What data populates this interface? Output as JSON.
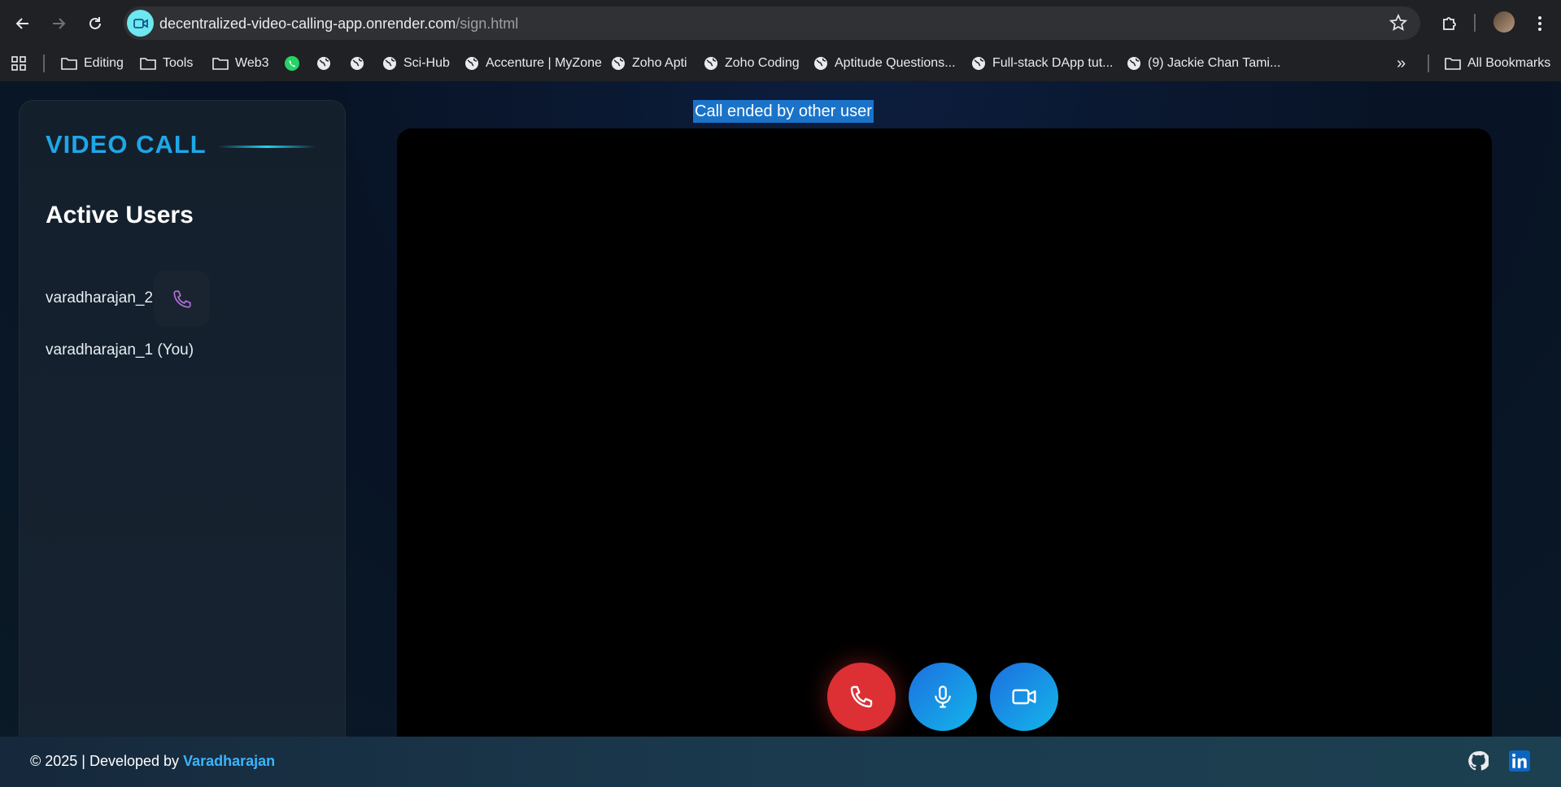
{
  "browser": {
    "url_host": "decentralized-video-calling-app.onrender.com",
    "url_path": "/sign.html",
    "bookmarks": [
      {
        "label": "Editing",
        "icon": "folder-icon"
      },
      {
        "label": "Tools",
        "icon": "folder-icon"
      },
      {
        "label": "Web3",
        "icon": "folder-icon"
      },
      {
        "label": "",
        "icon": "whatsapp-icon"
      },
      {
        "label": "",
        "icon": "globe-icon"
      },
      {
        "label": "",
        "icon": "globe-icon"
      },
      {
        "label": "Sci-Hub",
        "icon": "globe-icon"
      },
      {
        "label": "Accenture | MyZone",
        "icon": "globe-icon"
      },
      {
        "label": "Zoho Apti",
        "icon": "globe-icon"
      },
      {
        "label": "Zoho Coding",
        "icon": "globe-icon"
      },
      {
        "label": "Aptitude Questions...",
        "icon": "globe-icon"
      },
      {
        "label": "Full-stack DApp tut...",
        "icon": "globe-icon"
      },
      {
        "label": "(9) Jackie Chan Tami...",
        "icon": "globe-icon"
      }
    ],
    "overflow_label": "»",
    "all_bookmarks_label": "All Bookmarks"
  },
  "sidebar": {
    "brand": "VIDEO CALL",
    "active_users_title": "Active Users",
    "users": [
      {
        "name": "varadharajan_2"
      },
      {
        "name": "varadharajan_1 (You)"
      }
    ]
  },
  "main": {
    "status": "Call ended by other user"
  },
  "controls": {
    "end_call_icon": "phone-icon",
    "mic_icon": "microphone-icon",
    "camera_icon": "video-camera-icon"
  },
  "footer": {
    "copyright": "© 2025 | Developed by ",
    "developer": "Varadharajan"
  },
  "colors": {
    "accent": "#1ea7e8",
    "end_call": "#dc3034",
    "selection": "#1a73c9",
    "call_icon": "#b06fd8"
  }
}
